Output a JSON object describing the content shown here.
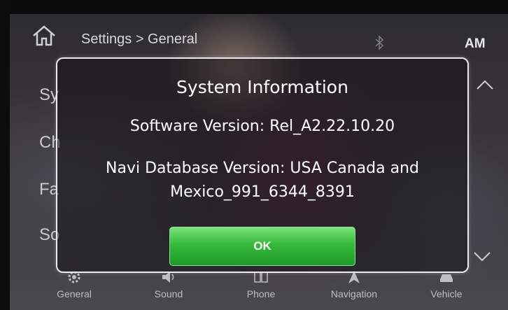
{
  "header": {
    "breadcrumb": "Settings > General",
    "radio_band": "AM"
  },
  "settings_list": [
    "Sy",
    "Ch",
    "Fa",
    "So"
  ],
  "tabs": [
    {
      "label": "General",
      "icon": "gear-icon"
    },
    {
      "label": "Sound",
      "icon": "speaker-icon"
    },
    {
      "label": "Phone",
      "icon": "phone-icon"
    },
    {
      "label": "Navigation",
      "icon": "navigation-icon"
    },
    {
      "label": "Vehicle",
      "icon": "car-icon"
    }
  ],
  "dialog": {
    "title": "System Information",
    "software_version": "Software Version: Rel_A2.22.10.20",
    "navi_line1": "Navi Database Version: USA Canada and",
    "navi_line2": "Mexico_991_6344_8391",
    "ok_label": "OK"
  },
  "colors": {
    "ok_button": "#36b93b",
    "dialog_border": "#e9e9ee"
  }
}
